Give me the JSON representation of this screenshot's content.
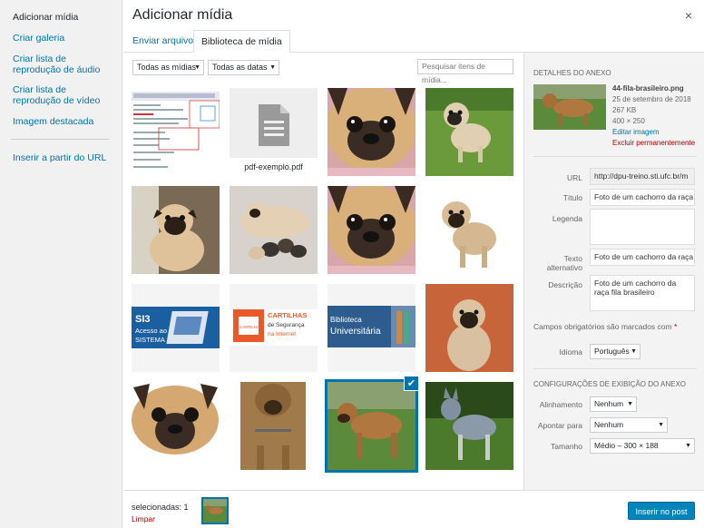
{
  "menu": {
    "items": [
      "Adicionar mídia",
      "Criar galeria",
      "Criar lista de reprodução de áudio",
      "Criar lista de reprodução de vídeo",
      "Imagem destacada",
      "Inserir a partir do URL"
    ]
  },
  "title": "Adicionar mídia",
  "close": "×",
  "tabs": {
    "upload": "Enviar arquivos",
    "library": "Biblioteca de mídia"
  },
  "filters": {
    "type": "Todas as mídias",
    "date": "Todas as datas",
    "search_placeholder": "Pesquisar itens de mídia..."
  },
  "grid": {
    "pdf_label": "pdf-exemplo.pdf",
    "banner1": "SI3 Acesso ao SISTEMA",
    "banner2_line1": "CARTILHAS",
    "banner2_line2": "de Segurança",
    "banner2_line3": "na Internet",
    "banner2_logo": "CARTILHA",
    "banner3_line1": "Biblioteca",
    "banner3_line2": "Universitária"
  },
  "details": {
    "heading": "Detalhes do anexo",
    "filename": "44-fila-brasileiro.png",
    "date": "25 de setembro de 2018",
    "size": "267 KB",
    "dims": "400 × 250",
    "edit": "Editar imagem",
    "delete": "Excluir permanentemente"
  },
  "fields": {
    "url_label": "URL",
    "url_value": "http://dpu-treino.sti.ufc.br/m",
    "title_label": "Título",
    "title_value": "Foto de um cachorro da raça",
    "caption_label": "Legenda",
    "caption_value": "",
    "alt_label_1": "Texto",
    "alt_label_2": "alternativo",
    "alt_value": "Foto de um cachorro da raça",
    "desc_label": "Descrição",
    "desc_value": "Foto de um cachorro da raça fila brasileiro",
    "required": "Campos obrigatórios são marcados com",
    "required_mark": "*",
    "lang_label": "Idioma",
    "lang_value": "Português"
  },
  "display": {
    "heading": "Configurações de exibição do anexo",
    "align_label": "Alinhamento",
    "align_value": "Nenhum",
    "link_label": "Apontar para",
    "link_value": "Nenhum",
    "size_label": "Tamanho",
    "size_value": "Médio – 300 × 188"
  },
  "footer": {
    "selected": "selecionadas: 1",
    "clear": "Limpar",
    "insert": "Inserir no post"
  },
  "colors": {
    "accent": "#0073aa",
    "danger": "#a00",
    "button": "#0085ba"
  }
}
